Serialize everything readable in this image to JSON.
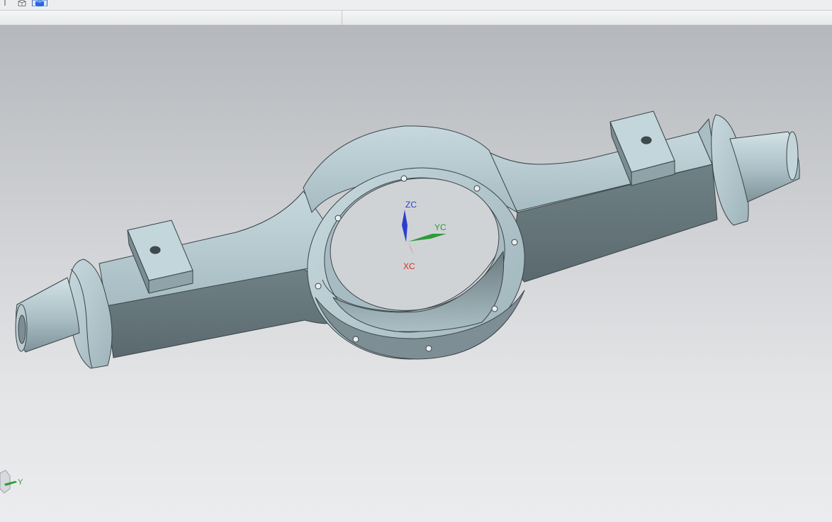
{
  "window": {
    "status_left": "",
    "status_right": ""
  },
  "toolbar": {
    "icons": [
      "wireframe-cube-icon",
      "shaded-cube-icon"
    ]
  },
  "viewport": {
    "model": "axle-housing",
    "wcs_axes": {
      "z_label": "ZC",
      "y_label": "YC",
      "x_label": "XC"
    },
    "view_triad": {
      "y_label": "Y"
    }
  },
  "colors": {
    "x_axis": "#d42a2a",
    "y_axis": "#2e9b3a",
    "z_axis": "#2a3fd1",
    "body_light": "#b7ccd2",
    "body_dark": "#637378",
    "edge": "#3a4448"
  }
}
